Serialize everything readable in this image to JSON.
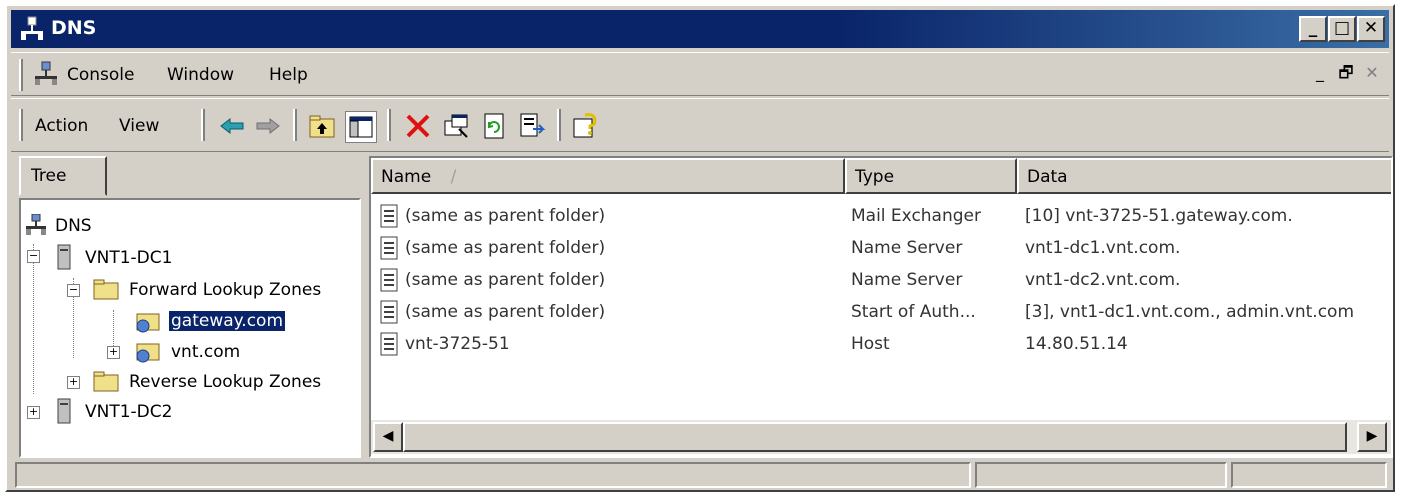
{
  "window": {
    "title": "DNS"
  },
  "title_buttons": {
    "minimize": "_",
    "maximize": "□",
    "close": "✕"
  },
  "menubar": {
    "items": [
      "Console",
      "Window",
      "Help"
    ],
    "mdi": {
      "minimize": "_",
      "restore": "🗗",
      "close": "✕"
    }
  },
  "toolbar": {
    "action_label": "Action",
    "view_label": "View",
    "icons": [
      "back-arrow-icon",
      "forward-arrow-icon",
      "up-folder-icon",
      "show-hide-tree-icon",
      "delete-icon",
      "properties-icon",
      "refresh-icon",
      "export-list-icon",
      "help-icon"
    ]
  },
  "tree": {
    "tab_label": "Tree",
    "root": "DNS",
    "server1": "VNT1-DC1",
    "forward_zones": "Forward Lookup Zones",
    "zone_selected": "gateway.com",
    "zone2": "vnt.com",
    "reverse_zones": "Reverse Lookup Zones",
    "server2": "VNT1-DC2"
  },
  "list": {
    "columns": [
      "Name",
      "Type",
      "Data"
    ],
    "sort_indicator": "/",
    "rows": [
      {
        "name": "(same as parent folder)",
        "type": "Mail Exchanger",
        "data": "[10]  vnt-3725-51.gateway.com."
      },
      {
        "name": "(same as parent folder)",
        "type": "Name Server",
        "data": "vnt1-dc1.vnt.com."
      },
      {
        "name": "(same as parent folder)",
        "type": "Name Server",
        "data": "vnt1-dc2.vnt.com."
      },
      {
        "name": "(same as parent folder)",
        "type": "Start of Auth...",
        "data": "[3], vnt1-dc1.vnt.com., admin.vnt.com"
      },
      {
        "name": "vnt-3725-51",
        "type": "Host",
        "data": "14.80.51.14"
      }
    ]
  },
  "colors": {
    "title_bar": "#0a246a",
    "face": "#d4d0c8",
    "selection": "#0a246a"
  }
}
